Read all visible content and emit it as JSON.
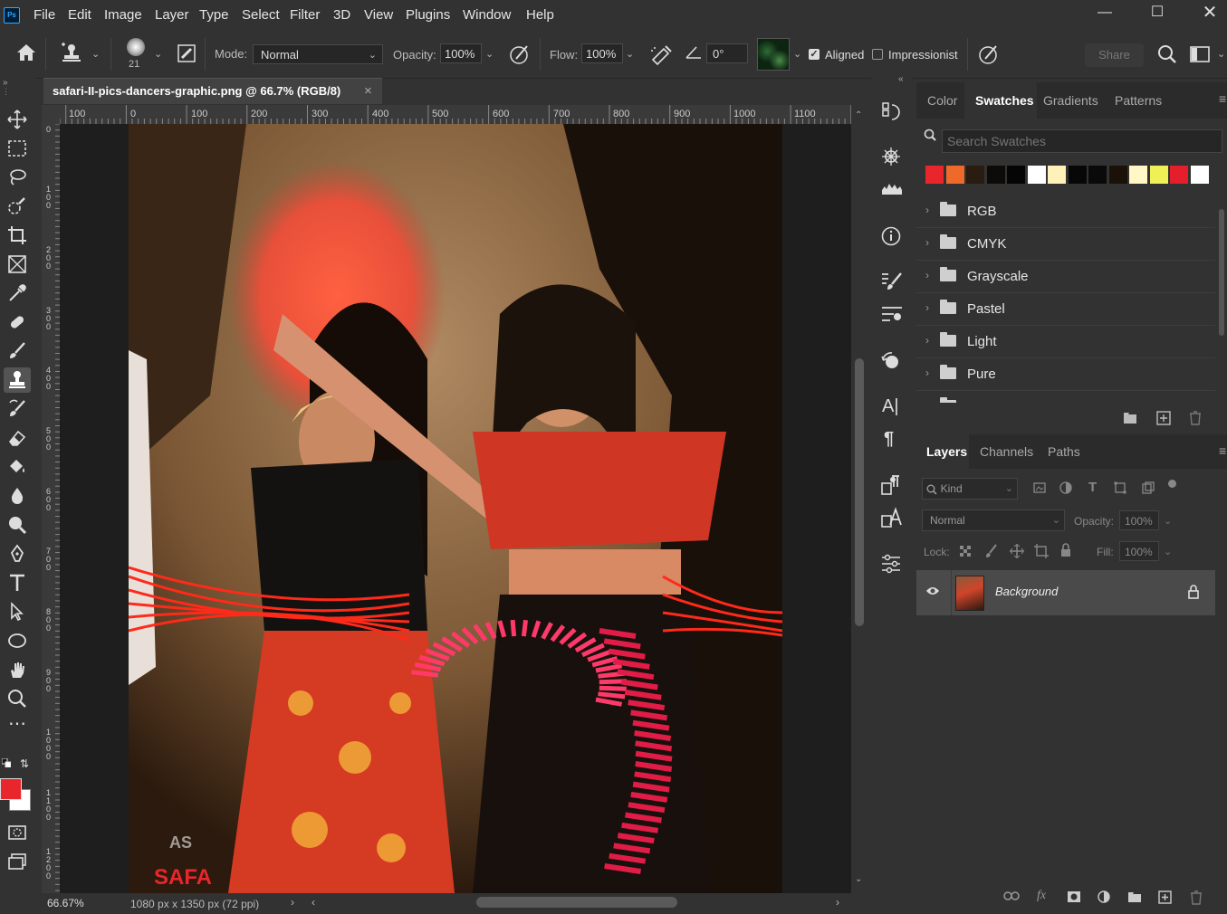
{
  "app": {
    "logo": "Ps"
  },
  "menu": [
    "File",
    "Edit",
    "Image",
    "Layer",
    "Type",
    "Select",
    "Filter",
    "3D",
    "View",
    "Plugins",
    "Window",
    "Help"
  ],
  "options": {
    "brush_size": "21",
    "mode_label": "Mode:",
    "mode_value": "Normal",
    "opacity_label": "Opacity:",
    "opacity_value": "100%",
    "flow_label": "Flow:",
    "flow_value": "100%",
    "angle_value": "0°",
    "aligned_label": "Aligned",
    "aligned_checked": true,
    "impressionist_label": "Impressionist",
    "impressionist_checked": false,
    "share_label": "Share"
  },
  "document": {
    "tab_title": "safari-II-pics-dancers-graphic.png @ 66.7% (RGB/8)",
    "close_glyph": "×",
    "zoom": "66.67%",
    "dimensions": "1080 px x 1350 px (72 ppi)"
  },
  "rulers": {
    "h_ticks": [
      "100",
      "0",
      "100",
      "200",
      "300",
      "400",
      "500",
      "600",
      "700",
      "800",
      "900",
      "1000",
      "1100"
    ],
    "v_ticks": [
      "0",
      "1 0 0",
      "2 0 0",
      "3 0 0",
      "4 0 0",
      "5 0 0",
      "6 0 0",
      "7 0 0",
      "8 0 0",
      "9 0 0",
      "1 0 0 0",
      "1 1 0 0",
      "1 2 0 0"
    ]
  },
  "swatches_panel": {
    "tabs": [
      "Color",
      "Swatches",
      "Gradients",
      "Patterns"
    ],
    "active_tab": "Swatches",
    "search_placeholder": "Search Swatches",
    "colors": [
      "#e8262b",
      "#ee6a2a",
      "#2a1c10",
      "#0d0b09",
      "#050505",
      "#ffffff",
      "#fff2b8",
      "#070707",
      "#0a0a0a",
      "#1a1208",
      "#fff7c6",
      "#eef055",
      "#e41e2a",
      "#ffffff"
    ],
    "groups": [
      "RGB",
      "CMYK",
      "Grayscale",
      "Pastel",
      "Light",
      "Pure"
    ]
  },
  "layers_panel": {
    "tabs": [
      "Layers",
      "Channels",
      "Paths"
    ],
    "active_tab": "Layers",
    "kind_label": "Kind",
    "blend_mode": "Normal",
    "opacity_label": "Opacity:",
    "opacity_value": "100%",
    "lock_label": "Lock:",
    "fill_label": "Fill:",
    "fill_value": "100%",
    "layers": [
      {
        "name": "Background",
        "visible": true,
        "locked": true
      }
    ]
  },
  "colors": {
    "foreground": "#e8262b",
    "background": "#ffffff",
    "accent": "#31a8ff"
  }
}
